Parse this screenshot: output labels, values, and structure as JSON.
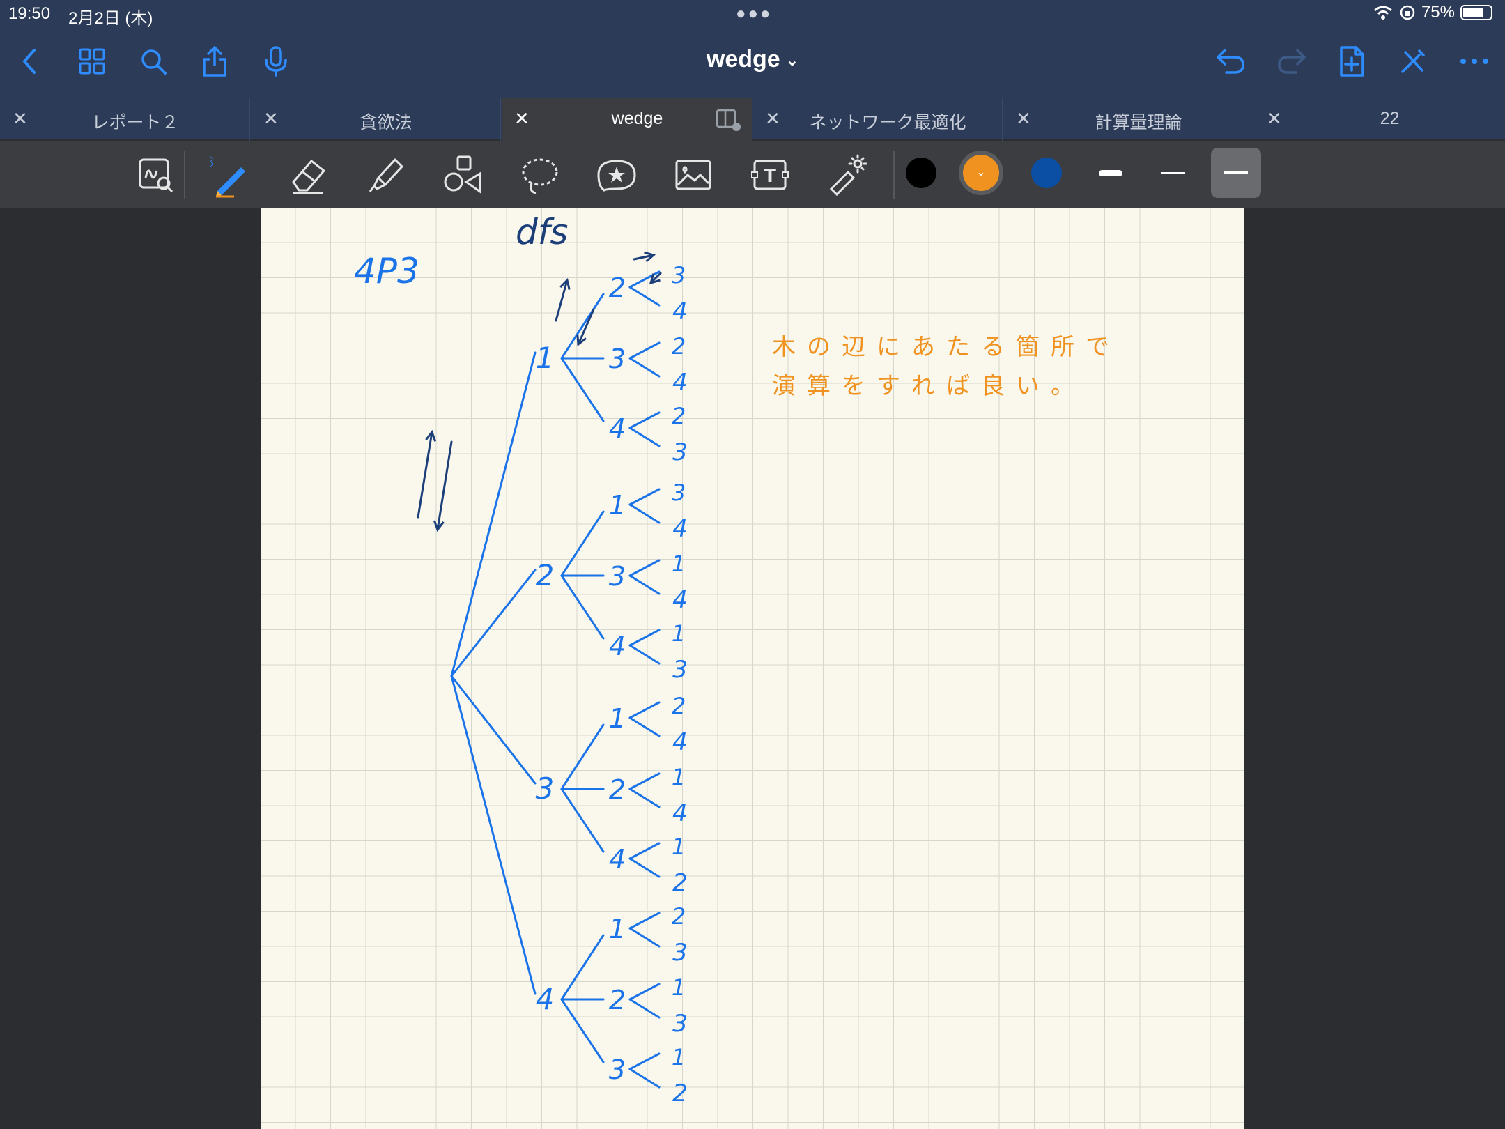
{
  "status": {
    "time": "19:50",
    "date": "2月2日 (木)",
    "battery": "75%",
    "battery_level": 0.75
  },
  "document": {
    "title": "wedge"
  },
  "tabs": [
    {
      "label": "レポート２"
    },
    {
      "label": "貪欲法"
    },
    {
      "label": "wedge"
    },
    {
      "label": "ネットワーク最適化"
    },
    {
      "label": "計算量理論"
    },
    {
      "label": "22"
    }
  ],
  "active_tab_index": 2,
  "toolbar": {
    "tools": [
      "zoom-window-icon",
      "pen-icon",
      "eraser-icon",
      "highlighter-icon",
      "shapes-icon",
      "lasso-icon",
      "sticker-icon",
      "image-icon",
      "text-icon",
      "laser-pointer-icon"
    ],
    "colors": [
      "#000000",
      "#f0921f",
      "#0a4fa3"
    ],
    "selected_color": "#f0921f",
    "selected_stroke_index": 2
  },
  "notebook": {
    "title_note": "4P3",
    "dfs_label": "dfs",
    "note_line1": "木の辺にあたる箇所で",
    "note_line2": "演算をすれば良い。",
    "tree": {
      "root_children": [
        "1",
        "2",
        "3",
        "4"
      ],
      "level2": [
        [
          "2",
          "3",
          "4"
        ],
        [
          "1",
          "3",
          "4"
        ],
        [
          "1",
          "2",
          "4"
        ],
        [
          "1",
          "2",
          "3"
        ]
      ],
      "leaves": [
        [
          [
            "3",
            "4"
          ],
          [
            "2",
            "4"
          ],
          [
            "2",
            "3"
          ]
        ],
        [
          [
            "3",
            "4"
          ],
          [
            "1",
            "4"
          ],
          [
            "1",
            "3"
          ]
        ],
        [
          [
            "2",
            "4"
          ],
          [
            "1",
            "4"
          ],
          [
            "1",
            "2"
          ]
        ],
        [
          [
            "2",
            "3"
          ],
          [
            "1",
            "3"
          ],
          [
            "1",
            "2"
          ]
        ]
      ]
    }
  }
}
